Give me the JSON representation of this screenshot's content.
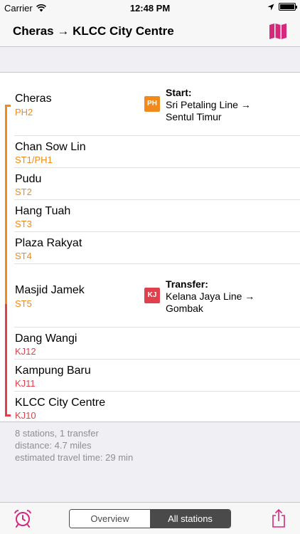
{
  "status_bar": {
    "carrier": "Carrier",
    "time": "12:48 PM",
    "battery_level": 1.0
  },
  "nav": {
    "title": "Cheras → KLCC City Centre",
    "map_icon": "map-icon",
    "map_icon_color": "#d6287c"
  },
  "colors": {
    "sri_petaling_line": "#f08a1c",
    "kelana_jaya_line": "#e0404b"
  },
  "stations": [
    {
      "name": "Cheras",
      "code": "PH2",
      "line": "sri_petaling_line"
    },
    {
      "name": "Chan Sow Lin",
      "code": "ST1/PH1",
      "line": "sri_petaling_line"
    },
    {
      "name": "Pudu",
      "code": "ST2",
      "line": "sri_petaling_line"
    },
    {
      "name": "Hang Tuah",
      "code": "ST3",
      "line": "sri_petaling_line"
    },
    {
      "name": "Plaza Rakyat",
      "code": "ST4",
      "line": "sri_petaling_line"
    },
    {
      "name": "Masjid Jamek",
      "code": "ST5",
      "line": "sri_petaling_line"
    },
    {
      "name": "Dang Wangi",
      "code": "KJ12",
      "line": "kelana_jaya_line"
    },
    {
      "name": "Kampung Baru",
      "code": "KJ11",
      "line": "kelana_jaya_line"
    },
    {
      "name": "KLCC City Centre",
      "code": "KJ10",
      "line": "kelana_jaya_line"
    }
  ],
  "start_note": {
    "badge": "PH",
    "title": "Start:",
    "text": "Sri Petaling Line →\nSentul Timur"
  },
  "transfer_note": {
    "badge": "KJ",
    "title": "Transfer:",
    "text": "Kelana Jaya Line →\nGombak"
  },
  "summary": {
    "line1": "8 stations, 1 transfer",
    "line2": "distance: 4.7 miles",
    "line3": "estimated travel time: 29 min"
  },
  "toolbar": {
    "alarm_icon": "alarm-clock-icon",
    "share_icon": "share-icon",
    "segments": [
      {
        "label": "Overview",
        "selected": false
      },
      {
        "label": "All stations",
        "selected": true
      }
    ]
  }
}
